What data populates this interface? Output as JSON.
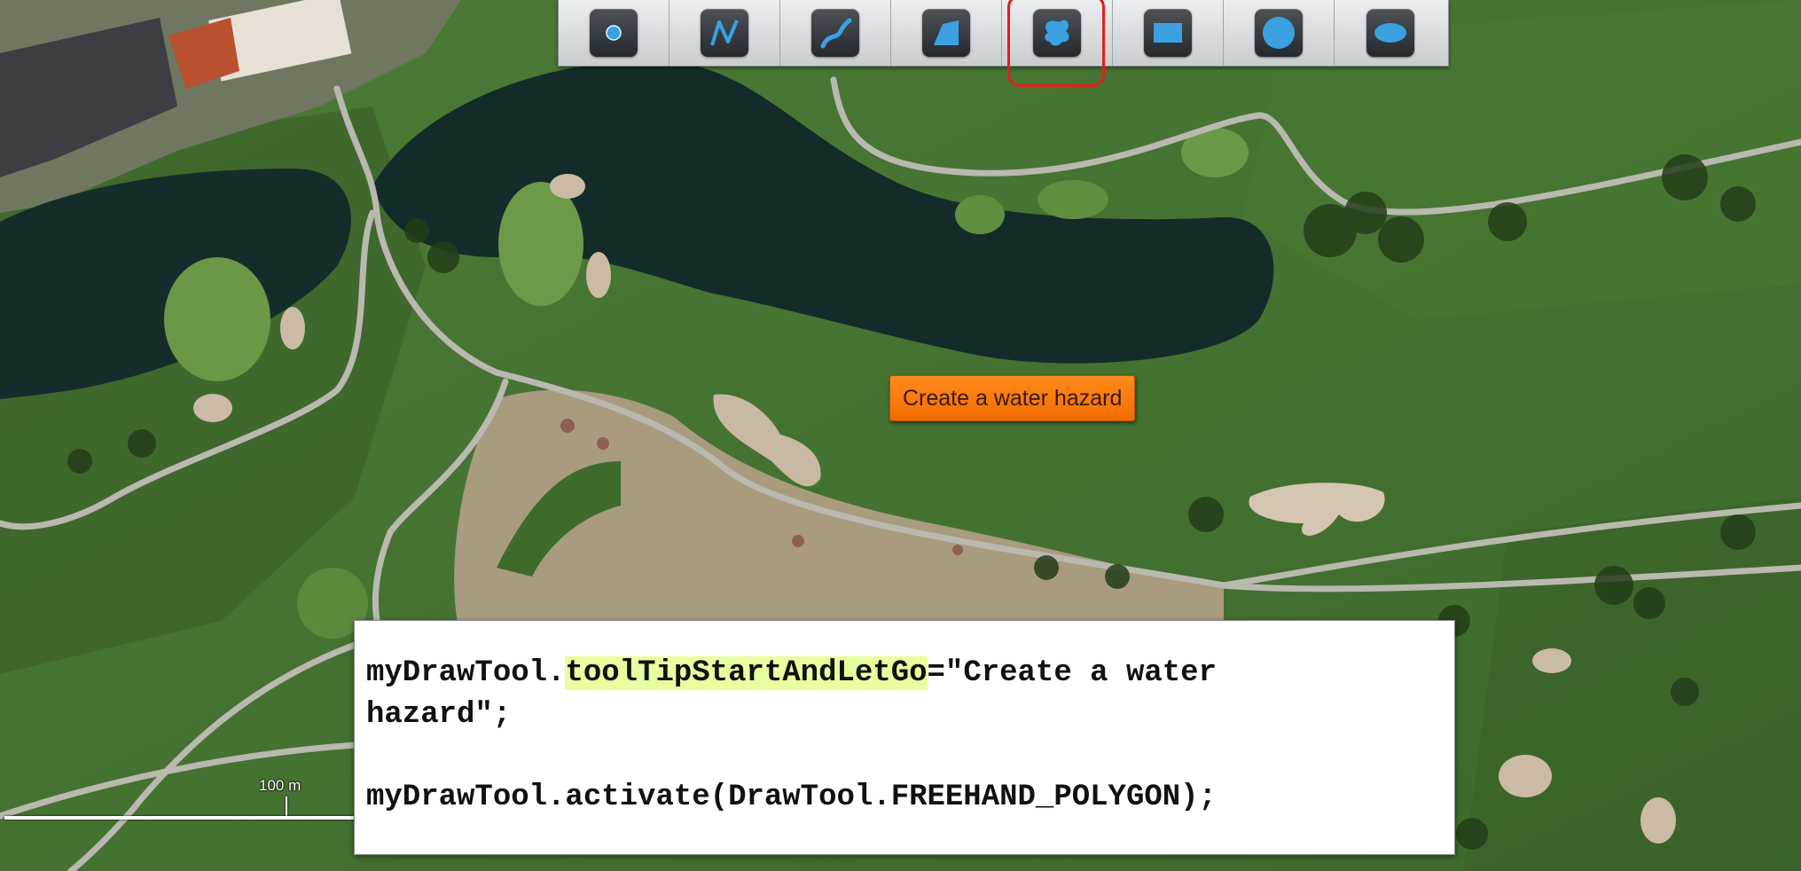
{
  "toolbar": {
    "tools": [
      {
        "icon": "point-icon"
      },
      {
        "icon": "polyline-icon"
      },
      {
        "icon": "freehand-polyline-icon"
      },
      {
        "icon": "polygon-icon"
      },
      {
        "icon": "freehand-polygon-icon",
        "selected": true
      },
      {
        "icon": "rectangle-icon"
      },
      {
        "icon": "circle-icon"
      },
      {
        "icon": "ellipse-icon"
      }
    ],
    "icon_color": "#3ba1e0",
    "selected_outline_color": "#e0201c"
  },
  "tooltip": {
    "text": "Create a water hazard",
    "color": "#f47a0a"
  },
  "scale": {
    "label": "100 m"
  },
  "code": {
    "line1_prefix": "myDrawTool.",
    "line1_highlight": "toolTipStartAndLetGo",
    "line1_suffix": "=\"Create a water",
    "line2": "hazard\";",
    "line3": "myDrawTool.activate(DrawTool.FREEHAND_POLYGON);",
    "highlight_color": "#e7ff9e"
  }
}
